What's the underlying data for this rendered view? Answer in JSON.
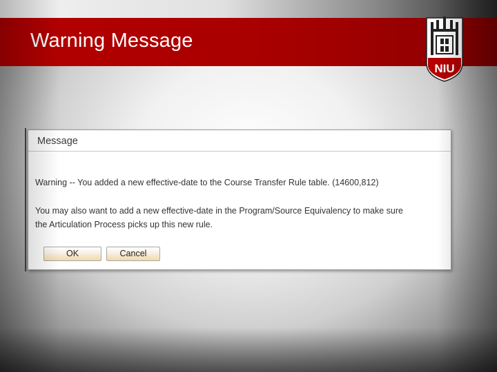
{
  "slide": {
    "title": "Warning Message"
  },
  "logo": {
    "text": "NIU",
    "icon": "niu-tower-logo"
  },
  "dialog": {
    "title": "Message",
    "warning_text": "Warning -- You added a new effective-date to the Course Transfer Rule table. (14600,812)",
    "info_line1": "You may also want to add a new effective-date in the Program/Source Equivalency to make sure",
    "info_line2": "the Articulation Process picks up this new rule.",
    "ok_label": "OK",
    "cancel_label": "Cancel"
  },
  "colors": {
    "title_bar": "#a80000",
    "button_gradient_end": "#f3d9a8"
  }
}
